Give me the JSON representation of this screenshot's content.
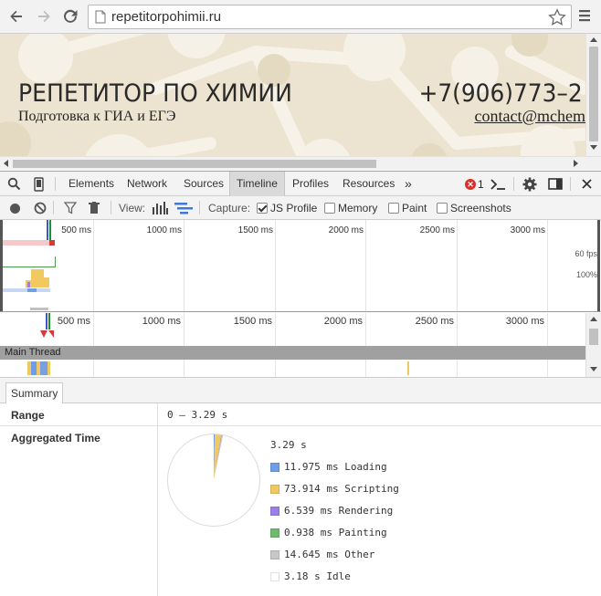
{
  "browser": {
    "url": "repetitorpohimii.ru"
  },
  "site": {
    "title": "РЕПЕТИТОР ПО ХИМИИ",
    "subtitle": "Подготовка к ГИА и ЕГЭ",
    "phone": "+7(906)773–2",
    "email": "contact@mchem"
  },
  "devtools": {
    "tabs": [
      {
        "label": "Elements",
        "active": false
      },
      {
        "label": "Network",
        "active": false
      },
      {
        "label": "Sources",
        "active": false
      },
      {
        "label": "Timeline",
        "active": true
      },
      {
        "label": "Profiles",
        "active": false
      },
      {
        "label": "Resources",
        "active": false
      }
    ],
    "more_tabs": "»",
    "error_count": "1",
    "toolbar": {
      "view_label": "View:",
      "capture_label": "Capture:",
      "checkboxes": [
        {
          "label": "JS Profile",
          "checked": true
        },
        {
          "label": "Memory",
          "checked": false
        },
        {
          "label": "Paint",
          "checked": false
        },
        {
          "label": "Screenshots",
          "checked": false
        }
      ]
    },
    "overview": {
      "ticks": [
        "500 ms",
        "1000 ms",
        "1500 ms",
        "2000 ms",
        "2500 ms",
        "3000 ms"
      ],
      "fps_label": "60 fps",
      "cpu_label": "100%"
    },
    "flame": {
      "ticks": [
        "500 ms",
        "1000 ms",
        "1500 ms",
        "2000 ms",
        "2500 ms",
        "3000 ms"
      ],
      "main_thread_label": "Main Thread"
    },
    "summary": {
      "tab_label": "Summary",
      "range_key": "Range",
      "range_value": "0 – 3.29 s",
      "aggregated_key": "Aggregated Time",
      "total": "3.29 s",
      "items": [
        {
          "label": "11.975 ms Loading",
          "ms": 11.975,
          "color": "#6f9ee6"
        },
        {
          "label": "73.914 ms Scripting",
          "ms": 73.914,
          "color": "#f2c861"
        },
        {
          "label": "6.539 ms Rendering",
          "ms": 6.539,
          "color": "#9b7fe6"
        },
        {
          "label": "0.938 ms Painting",
          "ms": 0.938,
          "color": "#6ebb6b"
        },
        {
          "label": "14.645 ms Other",
          "ms": 14.645,
          "color": "#c7c7c7"
        },
        {
          "label": "3.18 s Idle",
          "ms": 3180,
          "color": "#ffffff"
        }
      ]
    }
  }
}
